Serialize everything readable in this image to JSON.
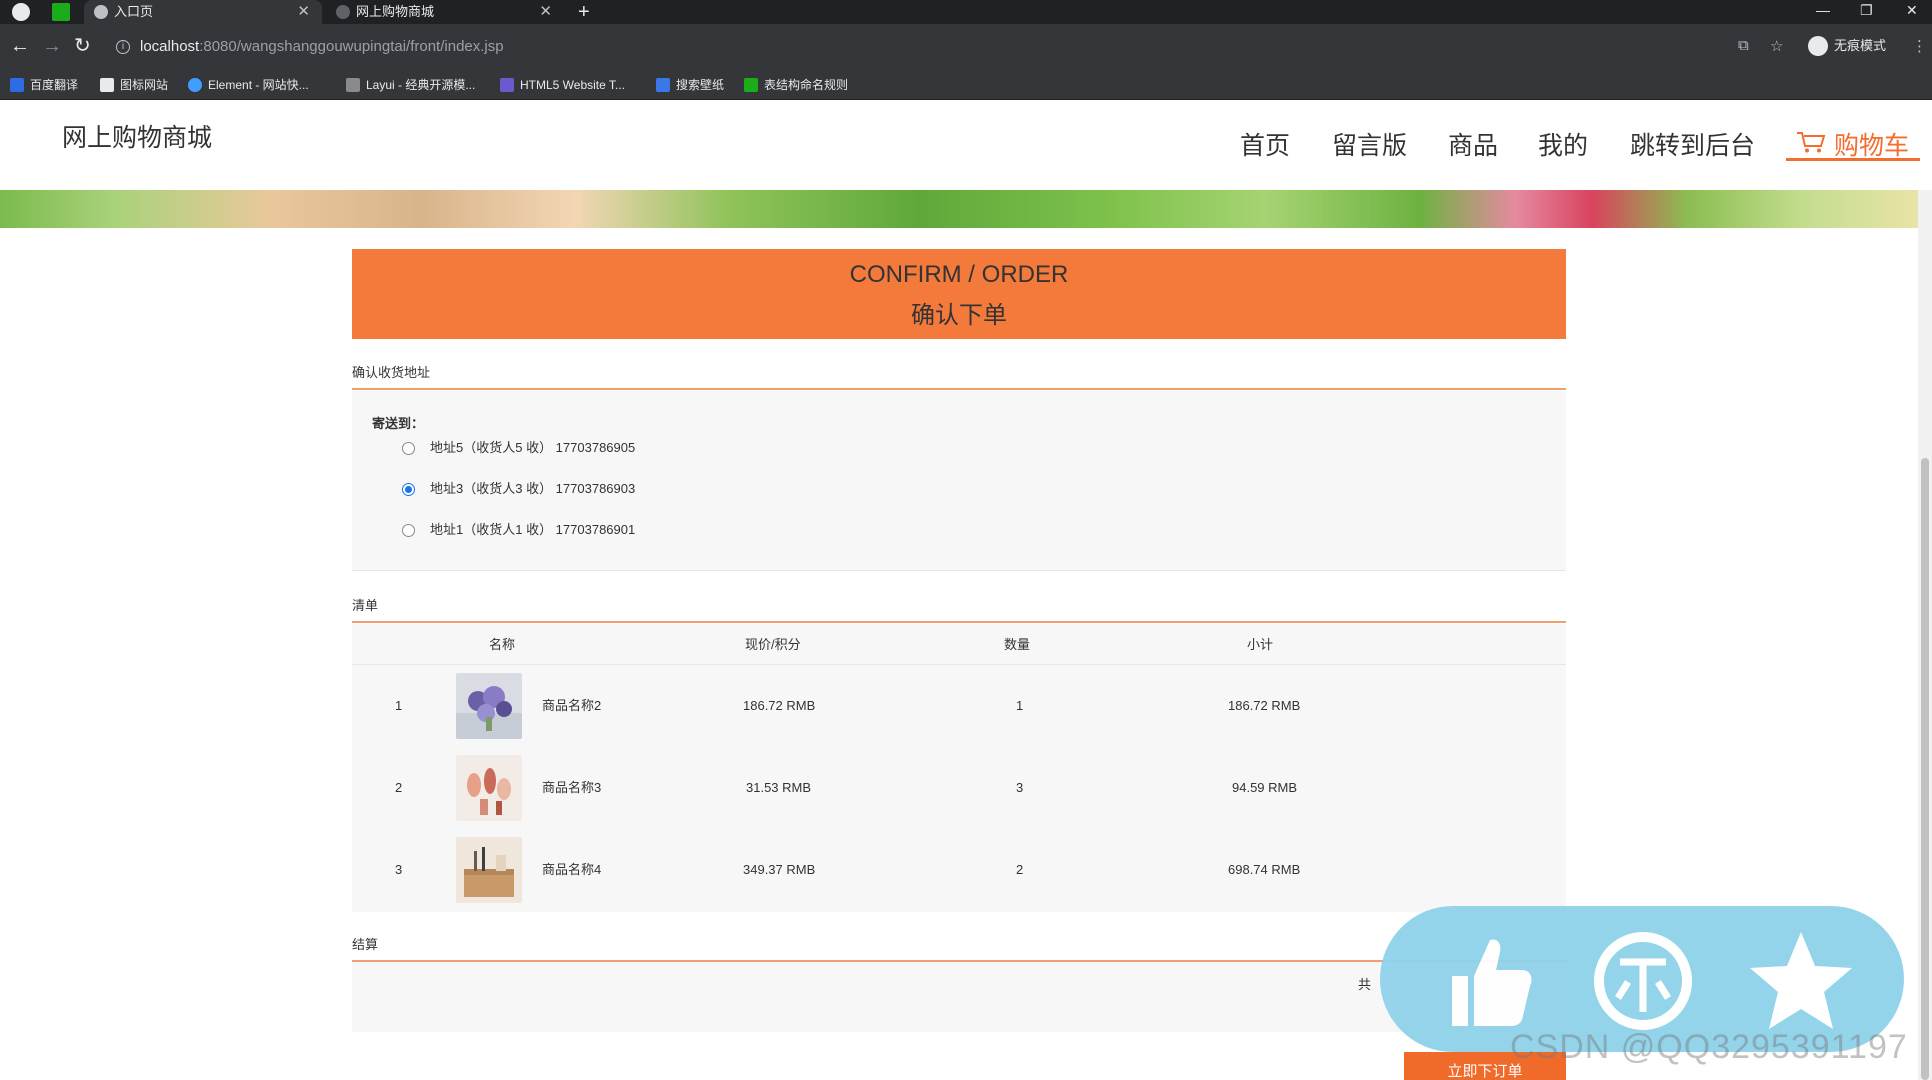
{
  "browser": {
    "tabs": [
      {
        "label": "入口页",
        "active": true
      },
      {
        "label": "网上购物商城",
        "active": false
      }
    ],
    "new_tab": "+",
    "url_host": "localhost",
    "url_path": ":8080/wangshanggouwupingtai/front/index.jsp",
    "incognito_label": "无痕模式",
    "bookmarks": [
      {
        "label": "百度翻译",
        "color": "#2d6ce5"
      },
      {
        "label": "图标网站",
        "color": "#ffffff"
      },
      {
        "label": "Element - 网站快...",
        "color": "#409eff"
      },
      {
        "label": "Layui - 经典开源模...",
        "color": "#8a8a8a"
      },
      {
        "label": "HTML5 Website T...",
        "color": "#6a5acd"
      },
      {
        "label": "搜索壁纸",
        "color": "#3b78e7"
      },
      {
        "label": "表结构命名规则",
        "color": "#1aad19"
      }
    ]
  },
  "site": {
    "logo": "网上购物商城",
    "nav": [
      "首页",
      "留言版",
      "商品",
      "我的",
      "跳转到后台",
      "购物车"
    ],
    "accent_color": "#f56c2f"
  },
  "order": {
    "banner_en": "CONFIRM / ORDER",
    "banner_zh": "确认下单",
    "address_section_title": "确认收货地址",
    "ship_to_label": "寄送到：",
    "addresses": [
      {
        "text": "地址5（收货人5 收） 17703786905",
        "selected": false
      },
      {
        "text": "地址3（收货人3 收） 17703786903",
        "selected": true
      },
      {
        "text": "地址1（收货人1 收） 17703786901",
        "selected": false
      }
    ],
    "list_section_title": "清单",
    "columns": {
      "name": "名称",
      "price": "现价/积分",
      "qty": "数量",
      "subtotal": "小计"
    },
    "items": [
      {
        "index": "1",
        "name": "商品名称2",
        "price": "186.72 RMB",
        "qty": "1",
        "subtotal": "186.72 RMB",
        "thumb": "purple-flowers"
      },
      {
        "index": "2",
        "name": "商品名称3",
        "price": "31.53 RMB",
        "qty": "3",
        "subtotal": "94.59 RMB",
        "thumb": "cosmetics"
      },
      {
        "index": "3",
        "name": "商品名称4",
        "price": "349.37 RMB",
        "qty": "2",
        "subtotal": "698.74 RMB",
        "thumb": "desk-organizer"
      }
    ],
    "settle_section_title": "结算",
    "total_label": "共",
    "submit_label": "立即下订单"
  },
  "overlay": {
    "icons": [
      "thumbs-up-icon",
      "coin-icon",
      "star-icon"
    ],
    "watermark": "CSDN @QQ3295391197"
  }
}
